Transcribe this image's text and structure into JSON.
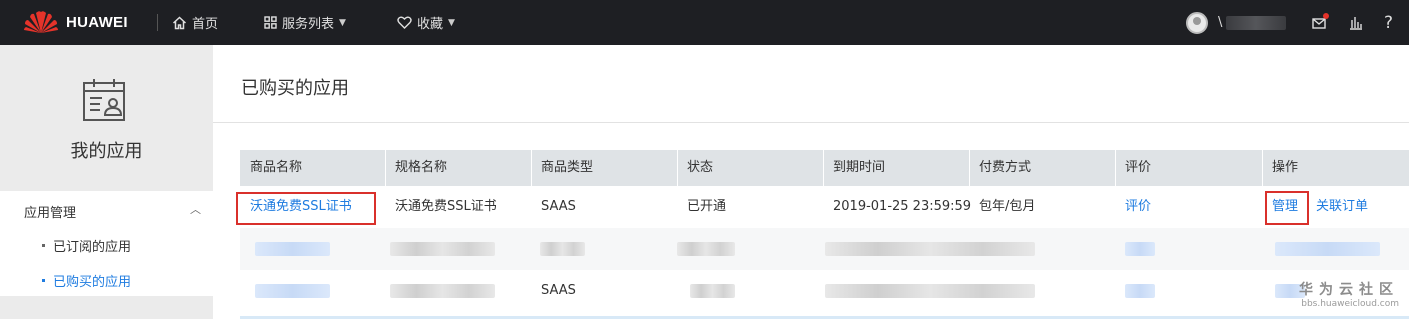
{
  "header": {
    "brand": "HUAWEI",
    "nav": [
      {
        "label": "首页",
        "icon": "home-icon"
      },
      {
        "label": "服务列表",
        "icon": "grid-icon"
      },
      {
        "label": "收藏",
        "icon": "heart-icon"
      }
    ],
    "user_initial": "\\",
    "right_icons": [
      "messages-icon",
      "stats-icon",
      "help-icon"
    ],
    "help_label": "?"
  },
  "sidebar": {
    "title": "我的应用",
    "group": {
      "label": "应用管理",
      "items": [
        {
          "label": "已订阅的应用",
          "active": false
        },
        {
          "label": "已购买的应用",
          "active": true
        }
      ]
    }
  },
  "main": {
    "title": "已购买的应用",
    "table": {
      "columns": [
        "商品名称",
        "规格名称",
        "商品类型",
        "状态",
        "到期时间",
        "付费方式",
        "评价",
        "操作"
      ],
      "rows": [
        {
          "product_name": "沃通免费SSL证书",
          "spec_name": "沃通免费SSL证书",
          "product_type": "SAAS",
          "status": "已开通",
          "expire_time": "2019-01-25 23:59:59",
          "payment": "包年/包月",
          "rating": "评价",
          "actions": [
            "管理",
            "关联订单"
          ]
        },
        {
          "blurred": true
        },
        {
          "blurred": true,
          "product_type": "SAAS"
        }
      ]
    }
  },
  "watermark": {
    "main": "华为云社区",
    "sub": "bbs.huaweicloud.com"
  },
  "colors": {
    "topbar": "#1e1f23",
    "link": "#1f7ce0",
    "highlight": "#d9302b",
    "table_header": "#dfe3e6",
    "sidebar": "#ebebeb"
  }
}
